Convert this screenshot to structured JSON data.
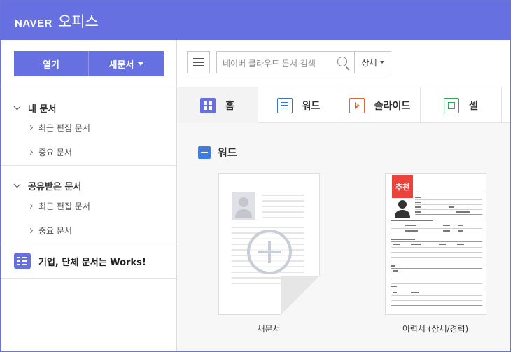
{
  "header": {
    "brand": "NAVER",
    "product": "오피스"
  },
  "sidebar": {
    "open_label": "열기",
    "new_label": "새문서",
    "sections": [
      {
        "title": "내 문서",
        "items": [
          "최근 편집 문서",
          "중요 문서"
        ]
      },
      {
        "title": "공유받은 문서",
        "items": [
          "최근 편집 문서",
          "중요 문서"
        ]
      }
    ],
    "works_label": "기업, 단체 문서는 Works!"
  },
  "toolbar": {
    "search_placeholder": "네이버 클라우드 문서 검색",
    "detail_label": "상세"
  },
  "tabs": [
    {
      "label": "홈",
      "icon": "home-grid-icon",
      "active": true
    },
    {
      "label": "워드",
      "icon": "word-icon",
      "color": "#3a72d6"
    },
    {
      "label": "슬라이드",
      "icon": "slide-icon",
      "color": "#e8622c"
    },
    {
      "label": "셀",
      "icon": "cell-icon",
      "color": "#2eaa56"
    }
  ],
  "section": {
    "title": "워드"
  },
  "templates": [
    {
      "label": "새문서"
    },
    {
      "label": "이력서 (상세/경력)",
      "badge": "추천"
    }
  ],
  "colors": {
    "accent": "#6670e0",
    "word": "#3a72d6",
    "slide": "#e8622c",
    "cell": "#2eaa56",
    "badge": "#e8443c"
  }
}
